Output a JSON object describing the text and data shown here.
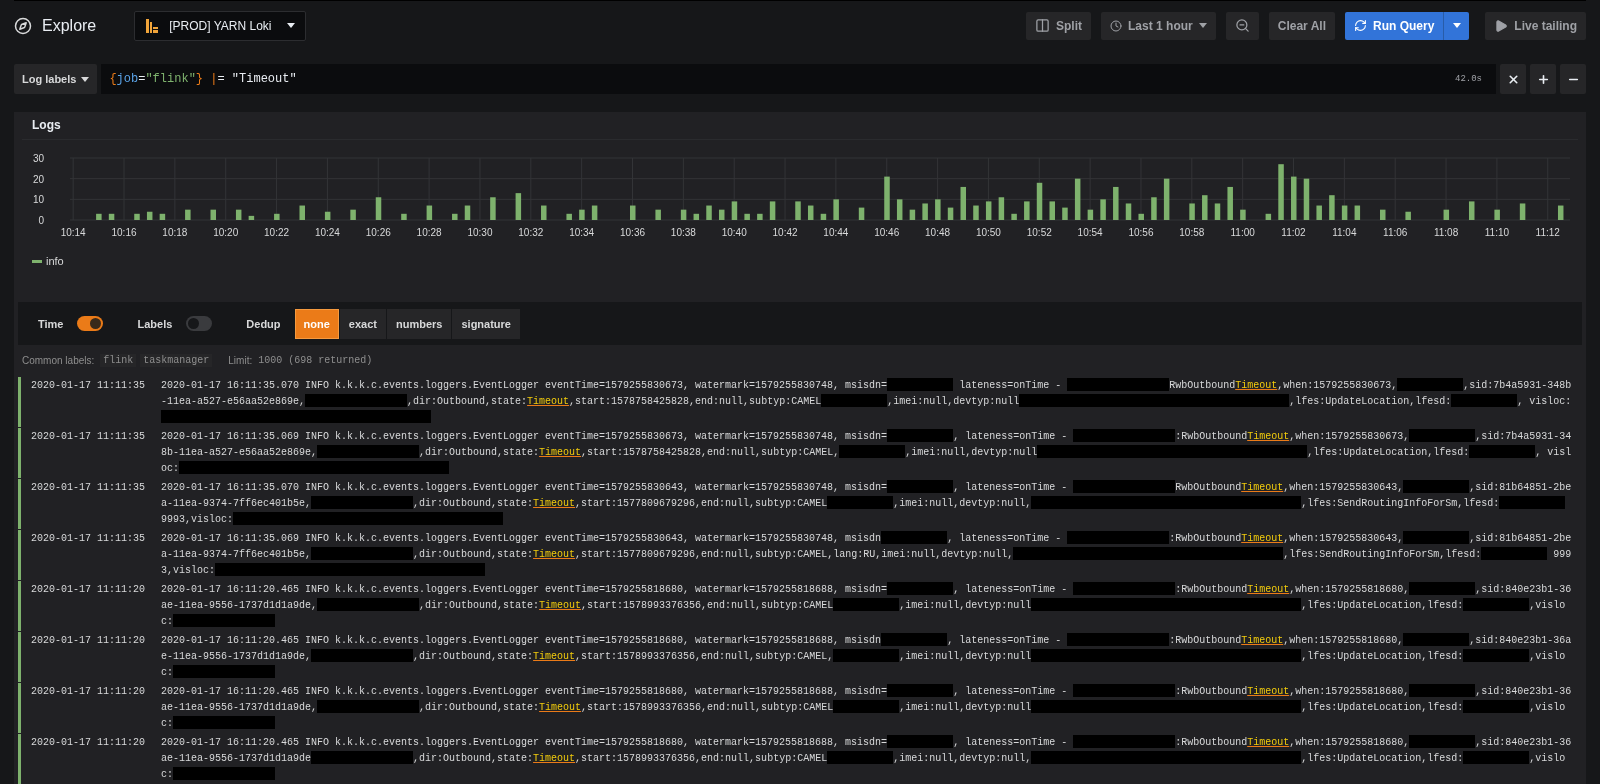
{
  "header": {
    "title": "Explore",
    "datasource": "[PROD] YARN Loki"
  },
  "toolbar": {
    "buttons": [
      {
        "kind": "split",
        "label": "Split"
      },
      {
        "kind": "time",
        "label": "Last 1 hour"
      },
      {
        "kind": "zoom"
      },
      {
        "kind": "clear",
        "label": "Clear All"
      },
      {
        "kind": "run",
        "label": "Run Query"
      },
      {
        "kind": "live",
        "label": "Live tailing"
      }
    ]
  },
  "query": {
    "picker": "Log labels",
    "tokens": [
      {
        "kind": "brace",
        "text": "{"
      },
      {
        "kind": "key",
        "text": "job"
      },
      {
        "kind": "plain",
        "text": "="
      },
      {
        "kind": "string",
        "text": "\"flink\""
      },
      {
        "kind": "brace",
        "text": "}"
      },
      {
        "kind": "pipe",
        "text": " |"
      },
      {
        "kind": "plain",
        "text": "= \"Timeout\""
      }
    ],
    "duration": "42.0s",
    "actions": [
      {
        "kind": "remove"
      },
      {
        "kind": "add"
      },
      {
        "kind": "collapse"
      }
    ]
  },
  "logs_panel": {
    "title": "Logs",
    "chart_data": {
      "type": "bar",
      "grid": true,
      "ylim": [
        0,
        30
      ],
      "yticks": [
        0,
        10,
        20,
        30
      ],
      "categories": [
        "10:14",
        null,
        null,
        null,
        "10:16",
        null,
        null,
        null,
        "10:18",
        null,
        null,
        null,
        "10:20",
        null,
        null,
        null,
        "10:22",
        null,
        null,
        null,
        "10:24",
        null,
        null,
        null,
        "10:26",
        null,
        null,
        null,
        "10:28",
        null,
        null,
        null,
        "10:30",
        null,
        null,
        null,
        "10:32",
        null,
        null,
        null,
        "10:34",
        null,
        null,
        null,
        "10:36",
        null,
        null,
        null,
        "10:38",
        null,
        null,
        null,
        "10:40",
        null,
        null,
        null,
        "10:42",
        null,
        null,
        null,
        "10:44",
        null,
        null,
        null,
        "10:46",
        null,
        null,
        null,
        "10:48",
        null,
        null,
        null,
        "10:50",
        null,
        null,
        null,
        "10:52",
        null,
        null,
        null,
        "10:54",
        null,
        null,
        null,
        "10:56",
        null,
        null,
        null,
        "10:58",
        null,
        null,
        null,
        "11:00",
        null,
        null,
        null,
        "11:02",
        null,
        null,
        null,
        "11:04",
        null,
        null,
        null,
        "11:06",
        null,
        null,
        null,
        "11:08",
        null,
        null,
        null,
        "11:10",
        null,
        null,
        null,
        "11:12",
        null
      ],
      "series": [
        {
          "name": "info",
          "color": "#7eb26d",
          "values": [
            null,
            null,
            3,
            3,
            null,
            3,
            4,
            3,
            null,
            5,
            null,
            5,
            null,
            5,
            2,
            null,
            3,
            null,
            7,
            null,
            4,
            null,
            5,
            null,
            11,
            null,
            3,
            null,
            7,
            null,
            3,
            7,
            null,
            11,
            null,
            13,
            null,
            7,
            null,
            3,
            5,
            7,
            null,
            null,
            7,
            null,
            5,
            null,
            5,
            3,
            7,
            5,
            9,
            3,
            3,
            9,
            null,
            9,
            7,
            3,
            10,
            null,
            6,
            null,
            21,
            10,
            5,
            8,
            10,
            6,
            16,
            7,
            9,
            11,
            3,
            9,
            18,
            9,
            6,
            20,
            5,
            10,
            16,
            8,
            3,
            11,
            20,
            null,
            8,
            12,
            8,
            16,
            5,
            null,
            3,
            27,
            21,
            20,
            7,
            12,
            7,
            7,
            null,
            5,
            null,
            4,
            null,
            null,
            5,
            null,
            9,
            null,
            5,
            null,
            8,
            null,
            null,
            7
          ]
        }
      ]
    }
  },
  "options": {
    "toggles": [
      {
        "label": "Time",
        "on": true
      },
      {
        "label": "Labels",
        "on": false
      }
    ],
    "dedup": {
      "label": "Dedup",
      "options": [
        {
          "label": "none",
          "selected": true
        },
        {
          "label": "exact",
          "selected": false
        },
        {
          "label": "numbers",
          "selected": false
        },
        {
          "label": "signature",
          "selected": false
        }
      ]
    }
  },
  "meta": {
    "common_labels_label": "Common labels:",
    "common_labels": [
      "flink",
      "taskmanager"
    ],
    "limit_label": "Limit:",
    "limit": "1000 (698 returned)"
  },
  "rows": [
    {
      "time": "2020-01-17 11:11:35",
      "parts": [
        {
          "kind": "text",
          "text": "2020-01-17 16:11:35.070 INFO k.k.k.c.events.loggers.EventLogger eventTime=1579255830673, watermark=1579255830748, msisdn="
        },
        {
          "kind": "redacted"
        },
        {
          "kind": "text",
          "text": " lateness=onTime - "
        },
        {
          "kind": "redacted_mid"
        },
        {
          "kind": "text",
          "text": "RwbOutbound"
        },
        {
          "kind": "match",
          "text": "Timeout"
        },
        {
          "kind": "text",
          "text": ",when:1579255830673,"
        },
        {
          "kind": "redacted"
        },
        {
          "kind": "text",
          "text": ",sid:7b4a5931-348b-11ea-a527-e56aa52e869e,"
        },
        {
          "kind": "redacted_mid"
        },
        {
          "kind": "text",
          "text": ",dir:Outbound,state:"
        },
        {
          "kind": "match",
          "text": "Timeout"
        },
        {
          "kind": "text",
          "text": ",start:1578758425828,end:null,subtyp:CAMEL"
        },
        {
          "kind": "redacted"
        },
        {
          "kind": "text",
          "text": ",imei:null,devtyp:null"
        },
        {
          "kind": "redacted_wide"
        },
        {
          "kind": "text",
          "text": ",lfes:UpdateLocation,lfesd:"
        },
        {
          "kind": "redacted"
        },
        {
          "kind": "text",
          "text": ", visloc:"
        },
        {
          "kind": "redacted_wide"
        }
      ]
    },
    {
      "time": "2020-01-17 11:11:35",
      "parts": [
        {
          "kind": "text",
          "text": "2020-01-17 16:11:35.069 INFO k.k.k.c.events.loggers.EventLogger eventTime=1579255830673, watermark=1579255830748, msisdn="
        },
        {
          "kind": "redacted"
        },
        {
          "kind": "text",
          "text": ", lateness=onTime - "
        },
        {
          "kind": "redacted_mid"
        },
        {
          "kind": "text",
          "text": ":RwbOutbound"
        },
        {
          "kind": "match",
          "text": "Timeout"
        },
        {
          "kind": "text",
          "text": ",when:1579255830673,"
        },
        {
          "kind": "redacted"
        },
        {
          "kind": "text",
          "text": ",sid:7b4a5931-348b-11ea-a527-e56aa52e869e,"
        },
        {
          "kind": "redacted_mid"
        },
        {
          "kind": "text",
          "text": ",dir:Outbound,state:"
        },
        {
          "kind": "match",
          "text": "Timeout"
        },
        {
          "kind": "text",
          "text": ",start:1578758425828,end:null,subtyp:CAMEL,"
        },
        {
          "kind": "redacted"
        },
        {
          "kind": "text",
          "text": ",imei:null,devtyp:null"
        },
        {
          "kind": "redacted_wide"
        },
        {
          "kind": "text",
          "text": ",lfes:UpdateLocation,lfesd:"
        },
        {
          "kind": "redacted"
        },
        {
          "kind": "text",
          "text": ", visloc:"
        },
        {
          "kind": "redacted_wide"
        }
      ]
    },
    {
      "time": "2020-01-17 11:11:35",
      "parts": [
        {
          "kind": "text",
          "text": "2020-01-17 16:11:35.070 INFO k.k.k.c.events.loggers.EventLogger eventTime=1579255830643, watermark=1579255830748, msisdn="
        },
        {
          "kind": "redacted"
        },
        {
          "kind": "text",
          "text": ", lateness=onTime - "
        },
        {
          "kind": "redacted_mid"
        },
        {
          "kind": "text",
          "text": "RwbOutbound"
        },
        {
          "kind": "match",
          "text": "Timeout"
        },
        {
          "kind": "text",
          "text": ",when:1579255830643,"
        },
        {
          "kind": "redacted"
        },
        {
          "kind": "text",
          "text": ",sid:81b64851-2bea-11ea-9374-7ff6ec401b5e,"
        },
        {
          "kind": "redacted_mid"
        },
        {
          "kind": "text",
          "text": ",dir:Outbound,state:"
        },
        {
          "kind": "match",
          "text": "Timeout"
        },
        {
          "kind": "text",
          "text": ",start:1577809679296,end:null,subtyp:CAMEL"
        },
        {
          "kind": "redacted"
        },
        {
          "kind": "text",
          "text": ",imei:null,devtyp:null,"
        },
        {
          "kind": "redacted_wide"
        },
        {
          "kind": "text",
          "text": ",lfes:SendRoutingInfoForSm,lfesd:"
        },
        {
          "kind": "redacted"
        },
        {
          "kind": "text",
          "text": " 9993,visloc:"
        },
        {
          "kind": "redacted_wide"
        }
      ]
    },
    {
      "time": "2020-01-17 11:11:35",
      "parts": [
        {
          "kind": "text",
          "text": "2020-01-17 16:11:35.069 INFO k.k.k.c.events.loggers.EventLogger eventTime=1579255830643, watermark=1579255830748, msisdn"
        },
        {
          "kind": "redacted"
        },
        {
          "kind": "text",
          "text": ", lateness=onTime - "
        },
        {
          "kind": "redacted_mid"
        },
        {
          "kind": "text",
          "text": ":RwbOutbound"
        },
        {
          "kind": "match",
          "text": "Timeout"
        },
        {
          "kind": "text",
          "text": ",when:1579255830643,"
        },
        {
          "kind": "redacted"
        },
        {
          "kind": "text",
          "text": ",sid:81b64851-2bea-11ea-9374-7ff6ec401b5e,"
        },
        {
          "kind": "redacted_mid"
        },
        {
          "kind": "text",
          "text": ",dir:Outbound,state:"
        },
        {
          "kind": "match",
          "text": "Timeout"
        },
        {
          "kind": "text",
          "text": ",start:1577809679296,end:null,subtyp:CAMEL,lang:RU,imei:null,devtyp:null,"
        },
        {
          "kind": "redacted_wide"
        },
        {
          "kind": "text",
          "text": ",lfes:SendRoutingInfoForSm,lfesd:"
        },
        {
          "kind": "redacted"
        },
        {
          "kind": "text",
          "text": " 9993,visloc:"
        },
        {
          "kind": "redacted_wide"
        }
      ]
    },
    {
      "time": "2020-01-17 11:11:20",
      "parts": [
        {
          "kind": "text",
          "text": "2020-01-17 16:11:20.465 INFO k.k.k.c.events.loggers.EventLogger eventTime=1579255818680, watermark=1579255818688, msisdn="
        },
        {
          "kind": "redacted"
        },
        {
          "kind": "text",
          "text": ", lateness=onTime - "
        },
        {
          "kind": "redacted_mid"
        },
        {
          "kind": "text",
          "text": ":RwbOutbound"
        },
        {
          "kind": "match",
          "text": "Timeout"
        },
        {
          "kind": "text",
          "text": ",when:1579255818680,"
        },
        {
          "kind": "redacted"
        },
        {
          "kind": "text",
          "text": ",sid:840e23b1-36ae-11ea-9556-1737d1d1a9de,"
        },
        {
          "kind": "redacted_mid"
        },
        {
          "kind": "text",
          "text": ",dir:Outbound,state:"
        },
        {
          "kind": "match",
          "text": "Timeout"
        },
        {
          "kind": "text",
          "text": ",start:1578993376356,end:null,subtyp:CAMEL"
        },
        {
          "kind": "redacted"
        },
        {
          "kind": "text",
          "text": ",imei:null,devtyp:null"
        },
        {
          "kind": "redacted_wide"
        },
        {
          "kind": "text",
          "text": ",lfes:UpdateLocation,lfesd:"
        },
        {
          "kind": "redacted"
        },
        {
          "kind": "text",
          "text": ",visloc:"
        },
        {
          "kind": "redacted_mid"
        }
      ]
    },
    {
      "time": "2020-01-17 11:11:20",
      "parts": [
        {
          "kind": "text",
          "text": "2020-01-17 16:11:20.465 INFO k.k.k.c.events.loggers.EventLogger eventTime=1579255818680, watermark=1579255818688, msisdn"
        },
        {
          "kind": "redacted"
        },
        {
          "kind": "text",
          "text": ", lateness=onTime - "
        },
        {
          "kind": "redacted_mid"
        },
        {
          "kind": "text",
          "text": ":RwbOutbound"
        },
        {
          "kind": "match",
          "text": "Timeout"
        },
        {
          "kind": "text",
          "text": ",when:1579255818680,"
        },
        {
          "kind": "redacted"
        },
        {
          "kind": "text",
          "text": ",sid:840e23b1-36ae-11ea-9556-1737d1d1a9de,"
        },
        {
          "kind": "redacted_mid"
        },
        {
          "kind": "text",
          "text": ",dir:Outbound,state:"
        },
        {
          "kind": "match",
          "text": "Timeout"
        },
        {
          "kind": "text",
          "text": ",start:1578993376356,end:null,subtyp:CAMEL,"
        },
        {
          "kind": "redacted"
        },
        {
          "kind": "text",
          "text": ",imei:null,devtyp:null"
        },
        {
          "kind": "redacted_wide"
        },
        {
          "kind": "text",
          "text": ",lfes:UpdateLocation,lfesd:"
        },
        {
          "kind": "redacted"
        },
        {
          "kind": "text",
          "text": ",visloc:"
        },
        {
          "kind": "redacted_mid"
        }
      ]
    },
    {
      "time": "2020-01-17 11:11:20",
      "parts": [
        {
          "kind": "text",
          "text": "2020-01-17 16:11:20.465 INFO k.k.k.c.events.loggers.EventLogger eventTime=1579255818680, watermark=1579255818688, msisdn="
        },
        {
          "kind": "redacted"
        },
        {
          "kind": "text",
          "text": ", lateness=onTime - "
        },
        {
          "kind": "redacted_mid"
        },
        {
          "kind": "text",
          "text": ":RwbOutbound"
        },
        {
          "kind": "match",
          "text": "Timeout"
        },
        {
          "kind": "text",
          "text": ",when:1579255818680,"
        },
        {
          "kind": "redacted"
        },
        {
          "kind": "text",
          "text": ",sid:840e23b1-36ae-11ea-9556-1737d1d1a9de,"
        },
        {
          "kind": "redacted_mid"
        },
        {
          "kind": "text",
          "text": ",dir:Outbound,state:"
        },
        {
          "kind": "match",
          "text": "Timeout"
        },
        {
          "kind": "text",
          "text": ",start:1578993376356,end:null,subtyp:CAMEL"
        },
        {
          "kind": "redacted"
        },
        {
          "kind": "text",
          "text": ",imei:null,devtyp:null"
        },
        {
          "kind": "redacted_wide"
        },
        {
          "kind": "text",
          "text": ",lfes:UpdateLocation,lfesd:"
        },
        {
          "kind": "redacted"
        },
        {
          "kind": "text",
          "text": ",visloc:"
        },
        {
          "kind": "redacted_mid"
        }
      ]
    },
    {
      "time": "2020-01-17 11:11:20",
      "parts": [
        {
          "kind": "text",
          "text": "2020-01-17 16:11:20.465 INFO k.k.k.c.events.loggers.EventLogger eventTime=1579255818680, watermark=1579255818688, msisdn="
        },
        {
          "kind": "redacted"
        },
        {
          "kind": "text",
          "text": ", lateness=onTime - "
        },
        {
          "kind": "redacted_mid"
        },
        {
          "kind": "text",
          "text": ":RwbOutbound"
        },
        {
          "kind": "match",
          "text": "Timeout"
        },
        {
          "kind": "text",
          "text": ",when:1579255818680,"
        },
        {
          "kind": "redacted"
        },
        {
          "kind": "text",
          "text": ",sid:840e23b1-36ae-11ea-9556-1737d1d1a9de"
        },
        {
          "kind": "redacted_mid"
        },
        {
          "kind": "text",
          "text": ",dir:Outbound,state:"
        },
        {
          "kind": "match",
          "text": "Timeout"
        },
        {
          "kind": "text",
          "text": ",start:1578993376356,end:null,subtyp:CAMEL"
        },
        {
          "kind": "redacted"
        },
        {
          "kind": "text",
          "text": ",imei:null,devtyp:null,"
        },
        {
          "kind": "redacted_wide"
        },
        {
          "kind": "text",
          "text": ",lfes:UpdateLocation,lfesd:"
        },
        {
          "kind": "redacted"
        },
        {
          "kind": "text",
          "text": ",visloc:"
        },
        {
          "kind": "redacted_mid"
        }
      ]
    }
  ]
}
